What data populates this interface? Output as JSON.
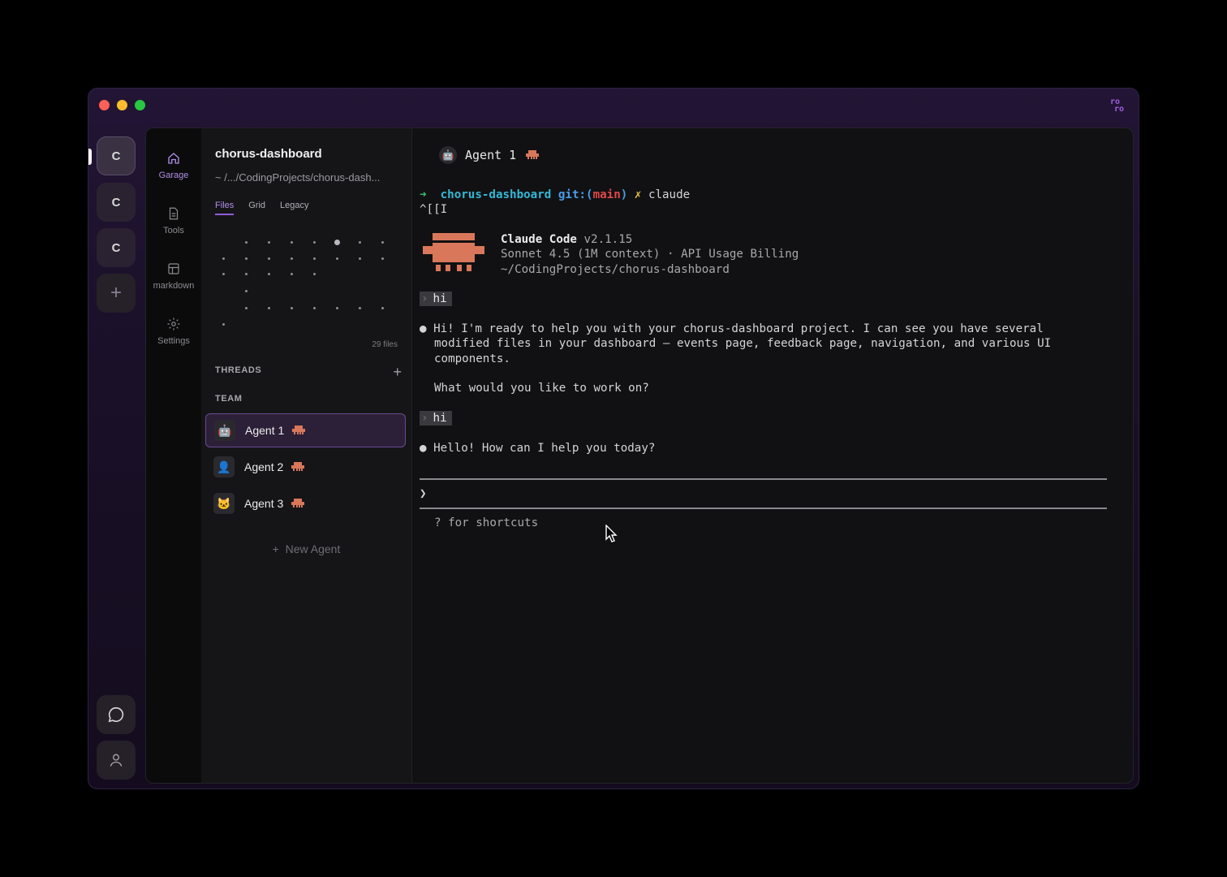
{
  "window": {
    "brand_mark_top": "ro",
    "brand_mark_bottom": "ro"
  },
  "workspaces": [
    {
      "label": "C",
      "active": true
    },
    {
      "label": "C",
      "active": false
    },
    {
      "label": "C",
      "active": false
    }
  ],
  "workspace_add_label": "+",
  "nav": {
    "items": [
      {
        "label": "Garage",
        "icon": "home-icon",
        "active": true
      },
      {
        "label": "Tools",
        "icon": "document-icon",
        "active": false
      },
      {
        "label": "markdown",
        "icon": "layout-icon",
        "active": false
      },
      {
        "label": "Settings",
        "icon": "gear-icon",
        "active": false
      }
    ]
  },
  "project": {
    "title": "chorus-dashboard",
    "path": "~ /.../CodingProjects/chorus-dash...",
    "tabs": [
      "Files",
      "Grid",
      "Legacy"
    ],
    "active_tab": "Files",
    "files_count": "29 files"
  },
  "threads_header": "THREADS",
  "threads_add": "+",
  "team_header": "TEAM",
  "agents": [
    {
      "name": "Agent 1",
      "avatar": "🤖",
      "active": true
    },
    {
      "name": "Agent 2",
      "avatar": "👤",
      "active": false
    },
    {
      "name": "Agent 3",
      "avatar": "🐱",
      "active": false
    }
  ],
  "new_agent": {
    "plus": "+",
    "label": "New Agent"
  },
  "terminal": {
    "header_agent": "Agent 1",
    "header_avatar": "🤖",
    "cmd_arrow": "➜",
    "cmd_dir": "chorus-dashboard",
    "cmd_git_prefix": "git:(",
    "cmd_branch": "main",
    "cmd_git_suffix": ")",
    "cmd_dirty": "✗",
    "cmd_text": "claude",
    "escape_line": "^[[I",
    "banner_name": "Claude Code",
    "banner_version": "v2.1.15",
    "banner_model": "Sonnet 4.5 (1M context) · API Usage Billing",
    "banner_path": "~/CodingProjects/chorus-dashboard",
    "prompt_marker": "›",
    "user_msg_1": "hi",
    "reply_1_line_1": "Hi! I'm ready to help you with your chorus-dashboard project. I can see you have several",
    "reply_1_line_2": "modified files in your dashboard – events page, feedback page, navigation, and various UI",
    "reply_1_line_3": "components.",
    "reply_1_line_4": "What would you like to work on?",
    "user_msg_2": "hi",
    "reply_2": "Hello! How can I help you today?",
    "input_prompt": "❯",
    "shortcuts_hint": "? for shortcuts"
  },
  "colors": {
    "accent": "#8f5bd8",
    "claude_logo": "#d9775a",
    "git_branch": "#e04848",
    "dir": "#35b8d6"
  }
}
